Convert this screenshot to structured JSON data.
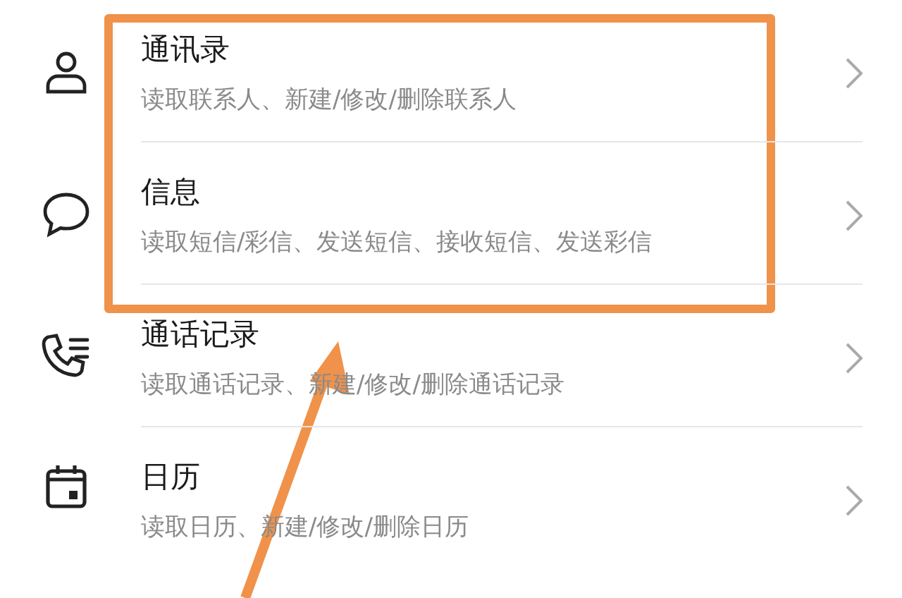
{
  "permissions": [
    {
      "kind": "contacts",
      "title": "通讯录",
      "description": "读取联系人、新建/修改/删除联系人",
      "highlighted": true
    },
    {
      "kind": "messages",
      "title": "信息",
      "description": "读取短信/彩信、发送短信、接收短信、发送彩信",
      "highlighted": true
    },
    {
      "kind": "calls",
      "title": "通话记录",
      "description": "读取通话记录、新建/修改/删除通话记录",
      "highlighted": false
    },
    {
      "kind": "calendar",
      "title": "日历",
      "description": "读取日历、新建/修改/删除日历",
      "highlighted": false
    }
  ]
}
